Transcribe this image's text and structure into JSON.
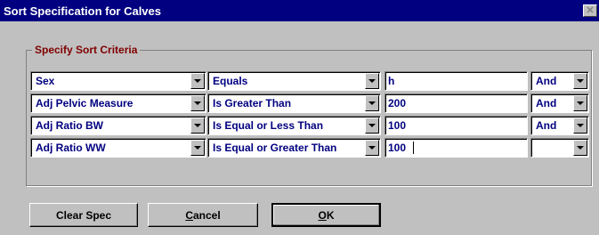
{
  "window": {
    "title": "Sort Specification for Calves",
    "close_glyph": "✕"
  },
  "group": {
    "legend": "Specify Sort Criteria"
  },
  "criteria": [
    {
      "field": "Sex",
      "operator": "Equals",
      "value": "h",
      "connector": "And"
    },
    {
      "field": "Adj Pelvic Measure",
      "operator": "Is Greater Than",
      "value": "200",
      "connector": "And"
    },
    {
      "field": "Adj Ratio BW",
      "operator": "Is Equal or Less Than",
      "value": "100",
      "connector": "And"
    },
    {
      "field": "Adj Ratio WW",
      "operator": "Is Equal or Greater Than",
      "value": "100",
      "connector": ""
    }
  ],
  "buttons": {
    "clear_spec": "Clear Spec",
    "cancel_mnemonic": "C",
    "cancel_rest": "ancel",
    "ok_mnemonic": "O",
    "ok_rest": "K"
  }
}
